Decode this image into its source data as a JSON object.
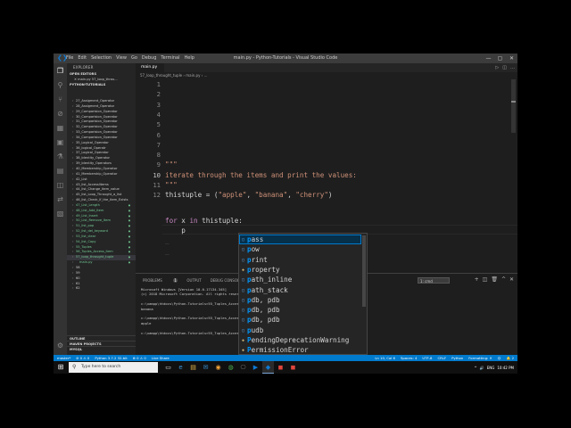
{
  "window": {
    "title": "main.py - Python-Tutorials - Visual Studio Code",
    "menu": [
      "File",
      "Edit",
      "Selection",
      "View",
      "Go",
      "Debug",
      "Terminal",
      "Help"
    ],
    "controls": [
      "—",
      "▢",
      "✕"
    ]
  },
  "sidebar": {
    "explorer_label": "EXPLORER",
    "open_editors_label": "OPEN EDITORS",
    "open_editor_file": "✕  main.py  57_loop_throu...",
    "project_label": "PYTHON-TUTORIALS",
    "files": [
      {
        "name": "27_Assigment_Operator",
        "green": false
      },
      {
        "name": "28_Assigment_Operator",
        "green": false
      },
      {
        "name": "29_Comparision_Operator",
        "green": false
      },
      {
        "name": "30_Comparision_Operator",
        "green": false
      },
      {
        "name": "31_Comparision_Operator",
        "green": false
      },
      {
        "name": "32_Comparision_Operator",
        "green": false
      },
      {
        "name": "33_Comparision_Operator",
        "green": false
      },
      {
        "name": "34_Comparision_Operator",
        "green": false
      },
      {
        "name": "35_Logical_Operator",
        "green": false
      },
      {
        "name": "36_logical_Operatr",
        "green": false
      },
      {
        "name": "37_Logical_Operator",
        "green": false
      },
      {
        "name": "38_Identity_Operator",
        "green": false
      },
      {
        "name": "39_Identity_Operators",
        "green": false
      },
      {
        "name": "40_Membership_Operator",
        "green": false
      },
      {
        "name": "41_Membership_Operator",
        "green": false
      },
      {
        "name": "42_List",
        "green": false
      },
      {
        "name": "43_list_Accesslitems",
        "green": false
      },
      {
        "name": "44_list_Change_item_value",
        "green": false
      },
      {
        "name": "45_list_Loop_Throught_a_list",
        "green": false
      },
      {
        "name": "46_list_Check_if_the_item_Exists",
        "green": false
      },
      {
        "name": "47_List_Length",
        "green": true
      },
      {
        "name": "48_List_Add_Item",
        "green": true
      },
      {
        "name": "49_List_Insert",
        "green": true
      },
      {
        "name": "50_List_Remove_Item",
        "green": true
      },
      {
        "name": "51_list_pop",
        "green": true
      },
      {
        "name": "52_list_del_keyword",
        "green": true
      },
      {
        "name": "53_list_clear",
        "green": true
      },
      {
        "name": "54_list_Copy",
        "green": true
      },
      {
        "name": "55_Tuples",
        "green": true
      },
      {
        "name": "56_Tuples_Access_item",
        "green": true
      },
      {
        "name": "57_loop_throught_tuple",
        "green": true,
        "selected": true
      },
      {
        "name": "main.py",
        "green": true,
        "child": true
      },
      {
        "name": "58",
        "green": false
      },
      {
        "name": "59",
        "green": false
      },
      {
        "name": "60",
        "green": false
      },
      {
        "name": "61",
        "green": false
      },
      {
        "name": "62",
        "green": false
      }
    ],
    "outline_label": "OUTLINE",
    "maven_label": "MAVEN PROJECTS",
    "mysql_label": "MYSQL"
  },
  "editor": {
    "tab_label": "main.py",
    "breadcrumb": "57_loop_throught_tuple  ›  main.py  ›  ...",
    "gutter": [
      "1",
      "2",
      "3",
      "4",
      "5",
      "6",
      "7",
      "8",
      "9",
      "10",
      "11",
      "12"
    ],
    "lines": {
      "l4": "\"\"\"",
      "l5": "iterate through the items and print the values:",
      "l6": "\"\"\"",
      "l7a": "thistuple = (",
      "l7b": "\"apple\"",
      "l7c": ", ",
      "l7d": "\"banana\"",
      "l7e": ", ",
      "l7f": "\"cherry\"",
      "l7g": ")",
      "l9a": "for",
      "l9b": " x ",
      "l9c": "in",
      "l9d": " thistuple:",
      "l10": "    p",
      "l11": "_",
      "l12": "_"
    }
  },
  "suggest": {
    "items": [
      {
        "label": "pass",
        "kind": "kw"
      },
      {
        "label": "pow",
        "kind": "fn"
      },
      {
        "label": "print",
        "kind": "fn"
      },
      {
        "label": "property",
        "kind": "prop"
      },
      {
        "label": "path_inline",
        "kind": "fn"
      },
      {
        "label": "path_stack",
        "kind": "fn"
      },
      {
        "label": "pdb, pdb",
        "kind": "fn"
      },
      {
        "label": "pdb, pdb",
        "kind": "fn"
      },
      {
        "label": "pdb, pdb",
        "kind": "fn"
      },
      {
        "label": "pudb",
        "kind": "fn"
      },
      {
        "label": "PendingDeprecationWarning",
        "kind": "prop"
      },
      {
        "label": "PermissionError",
        "kind": "prop"
      }
    ]
  },
  "panel": {
    "tabs": [
      "PROBLEMS",
      "OUTPUT",
      "DEBUG CONSOLE",
      "TERMINAL"
    ],
    "problems_count": "1",
    "terminal_select": "1: cmd",
    "lines": [
      "Microsoft Windows [Version 10.0.17134.345]",
      "(c) 2018 Microsoft Corporation. All rights reserved.",
      "",
      "c:\\xampp\\htdocs\\Python-Tutorials>55_Tuples_Access_Item>python main.py",
      "banana",
      "",
      "c:\\xampp\\htdocs\\Python-Tutorials>55_Tuples_Access_Item>python main.py",
      "apple",
      "",
      "c:\\xampp\\htdocs\\Python-Tutorials>55_Tuples_Access_Item>[]"
    ]
  },
  "statusbar": {
    "left": [
      "master*",
      "⊘ 0 ⚠ 0",
      "Python 3.7.2 32-bit",
      "⊗ 0 ⚠ 0",
      "Live Share"
    ],
    "right": [
      "Ln 10, Col 6",
      "Spaces: 4",
      "UTF-8",
      "CRLF",
      "Python",
      "Formatting: ✕",
      "☺",
      "🔔 2"
    ]
  },
  "taskbar": {
    "search_placeholder": "Type here to search",
    "apps": [
      "▭",
      "e",
      "▤",
      "✉",
      "◉",
      "◍",
      "⎔",
      "▶",
      "◆",
      "◼",
      "◼"
    ],
    "tray": [
      "^",
      "🔊",
      "ENG",
      "10:42 PM"
    ]
  }
}
